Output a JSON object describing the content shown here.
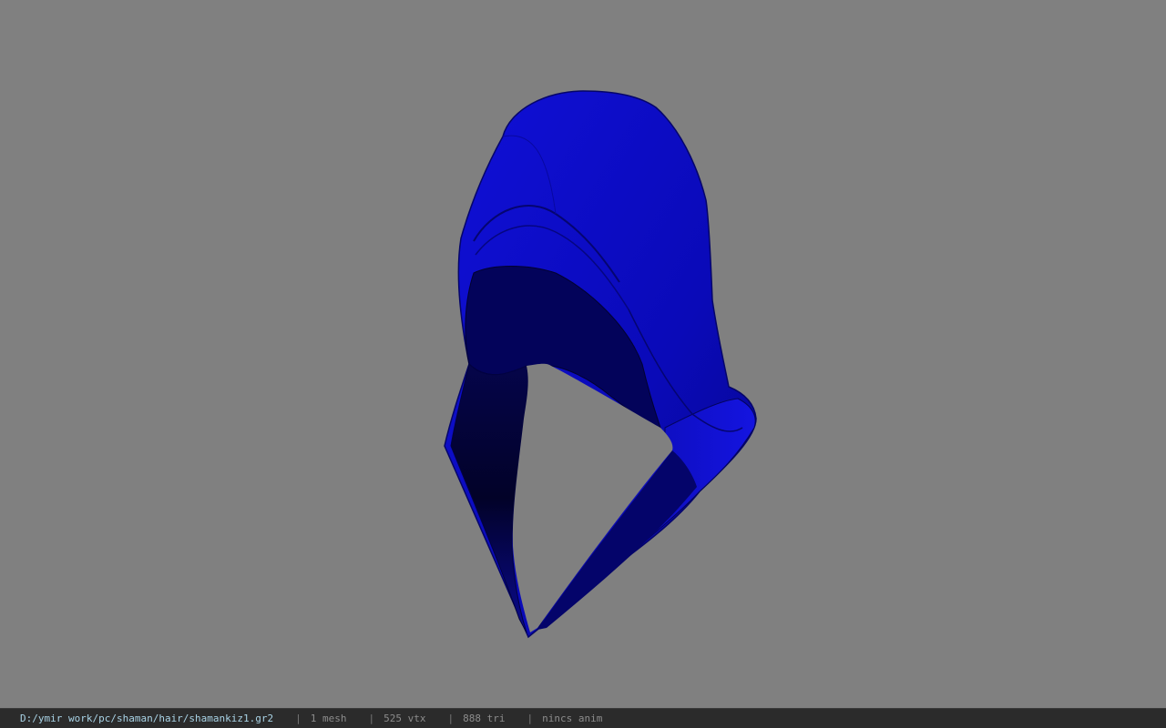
{
  "viewport": {
    "background_color": "#808080",
    "model_color": "#0a0ad0",
    "model_name": "hood-model"
  },
  "statusbar": {
    "file_path": "D:/ymir work/pc/shaman/hair/shamankiz1.gr2",
    "separator": "|",
    "mesh_count": "1 mesh",
    "vertex_count": "525 vtx",
    "triangle_count": "888 tri",
    "anim_status": "nincs anim"
  }
}
